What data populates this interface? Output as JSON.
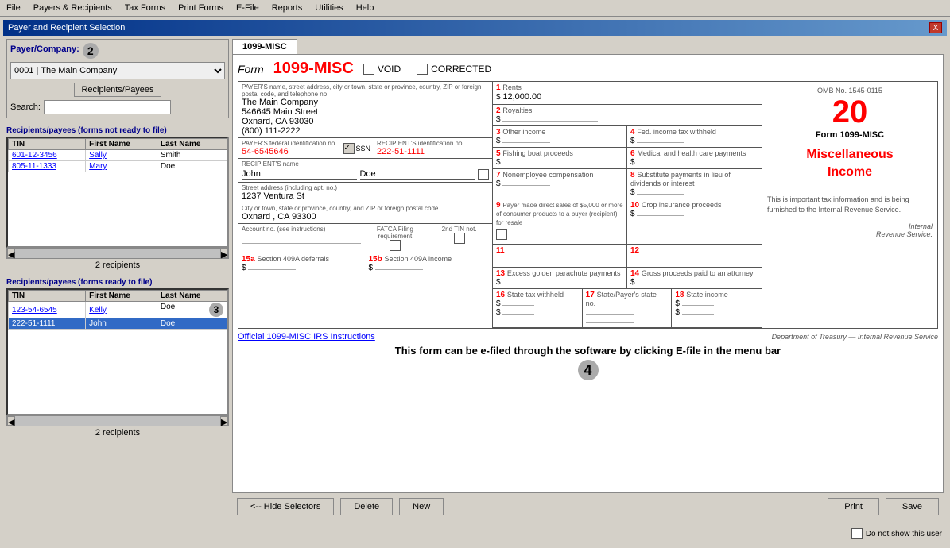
{
  "menubar": {
    "items": [
      "File",
      "Payers & Recipients",
      "Tax Forms",
      "Print Forms",
      "E-File",
      "Reports",
      "Utilities",
      "Help"
    ]
  },
  "window": {
    "title": "Payer and Recipient Selection",
    "close_label": "X"
  },
  "left_panel": {
    "payer_label": "Payer/Company:",
    "payer_step": "2",
    "payer_value": "0001 | The Main Company",
    "recipients_payees_btn": "Recipients/Payees",
    "search_label": "Search:",
    "search_placeholder": "",
    "not_ready_header": "Recipients/payees (forms not ready to file)",
    "not_ready_columns": [
      "TIN",
      "First Name",
      "Last Name"
    ],
    "not_ready_rows": [
      {
        "tin": "601-12-3456",
        "first": "Sally",
        "last": "Smith"
      },
      {
        "tin": "805-11-1333",
        "first": "Mary",
        "last": "Doe"
      }
    ],
    "not_ready_count": "2 recipients",
    "ready_header": "Recipients/payees (forms ready to file)",
    "ready_columns": [
      "TIN",
      "First Name",
      "Last Name"
    ],
    "ready_rows": [
      {
        "tin": "123-54-6545",
        "first": "Kelly",
        "last": "Doe",
        "step": "3"
      },
      {
        "tin": "222-51-1111",
        "first": "John",
        "last": "Doe",
        "selected": true
      }
    ],
    "ready_count": "2 recipients"
  },
  "form": {
    "tab_label": "1099-MISC",
    "form_label": "Form",
    "form_title": "1099-MISC",
    "void_label": "VOID",
    "corrected_label": "CORRECTED",
    "payer_name_hint": "PAYER'S name, street address, city or town, state or province, country, ZIP or foreign postal code, and telephone no.",
    "payer_name": "The Main Company",
    "payer_street": "546645 Main Street",
    "payer_city": "Oxnard, CA 93030",
    "payer_phone": "(800) 111-2222",
    "fed_id_hint": "PAYER'S federal identification no.",
    "fed_id_value": "54-6545646",
    "recipient_id_hint": "RECIPIENT'S identification no.",
    "recipient_id_value": "222-51-1111",
    "ssn_label": "SSN",
    "recipient_name_hint": "RECIPIENT'S name",
    "recipient_first": "John",
    "recipient_last": "Doe",
    "address_hint": "Street address (including apt. no.)",
    "address_value": "1237 Ventura St",
    "city_hint": "City or town, state or province, country, and ZIP or foreign postal code",
    "city_value": "Oxnard , CA 93300",
    "account_hint": "Account no. (see instructions)",
    "fatca_hint": "FATCA Filing requirement",
    "twotin_hint": "2nd TIN not.",
    "fields": [
      {
        "num": "1",
        "name": "Rents",
        "value": "12,000.00",
        "dollar": true
      },
      {
        "num": "2",
        "name": "Royalties",
        "value": "",
        "dollar": true
      },
      {
        "num": "3",
        "name": "Other income",
        "value": "",
        "dollar": true
      },
      {
        "num": "4",
        "name": "Fed. income tax withheld",
        "value": "",
        "dollar": true
      },
      {
        "num": "5",
        "name": "Fishing boat proceeds",
        "value": "",
        "dollar": true
      },
      {
        "num": "6",
        "name": "Medical and health care payments",
        "value": "",
        "dollar": true
      },
      {
        "num": "7",
        "name": "Nonemployee compensation",
        "value": "",
        "dollar": true
      },
      {
        "num": "8",
        "name": "Substitute payments in lieu of dividends or interest",
        "value": "",
        "dollar": true
      },
      {
        "num": "9",
        "name": "Payer made direct sales of $5,000 or more of consumer products to a buyer (recipient) for resale",
        "value": "",
        "dollar": false,
        "checkbox": true
      },
      {
        "num": "10",
        "name": "Crop insurance proceeds",
        "value": "",
        "dollar": true
      },
      {
        "num": "11",
        "name": "",
        "value": "",
        "dollar": false
      },
      {
        "num": "12",
        "name": "",
        "value": "",
        "dollar": false
      },
      {
        "num": "13",
        "name": "Excess golden parachute payments",
        "value": "",
        "dollar": true
      },
      {
        "num": "14",
        "name": "Gross proceeds paid to an attorney",
        "value": "",
        "dollar": true
      },
      {
        "num": "15a",
        "name": "Section 409A deferrals",
        "value": "",
        "dollar": true
      },
      {
        "num": "15b",
        "name": "Section 409A income",
        "value": "",
        "dollar": true
      },
      {
        "num": "16",
        "name": "State tax withheld",
        "value": "",
        "dollar": true
      },
      {
        "num": "17",
        "name": "State/Payer's state no.",
        "value": "",
        "dollar": false
      },
      {
        "num": "18",
        "name": "State income",
        "value": "",
        "dollar": true
      }
    ],
    "omb_text": "OMB No. 1545-0115",
    "year": "20",
    "form_name_right": "Form    1099-MISC",
    "misc_income_title": "Miscellaneous\nIncome",
    "tax_info": "This is important tax information and is being furnished to the Internal Revenue Service.",
    "irs_link": "Official 1099-MISC IRS Instructions",
    "dept_treasury": "Department of Treasury — Internal Revenue Service",
    "e_file_text": "This form can be e-filed through the software by clicking E-file in the menu bar",
    "step4": "4"
  },
  "bottom": {
    "hide_selectors": "<-- Hide Selectors",
    "delete": "Delete",
    "new": "New",
    "print": "Print",
    "save": "Save",
    "do_not_show": "Do not show this user"
  }
}
